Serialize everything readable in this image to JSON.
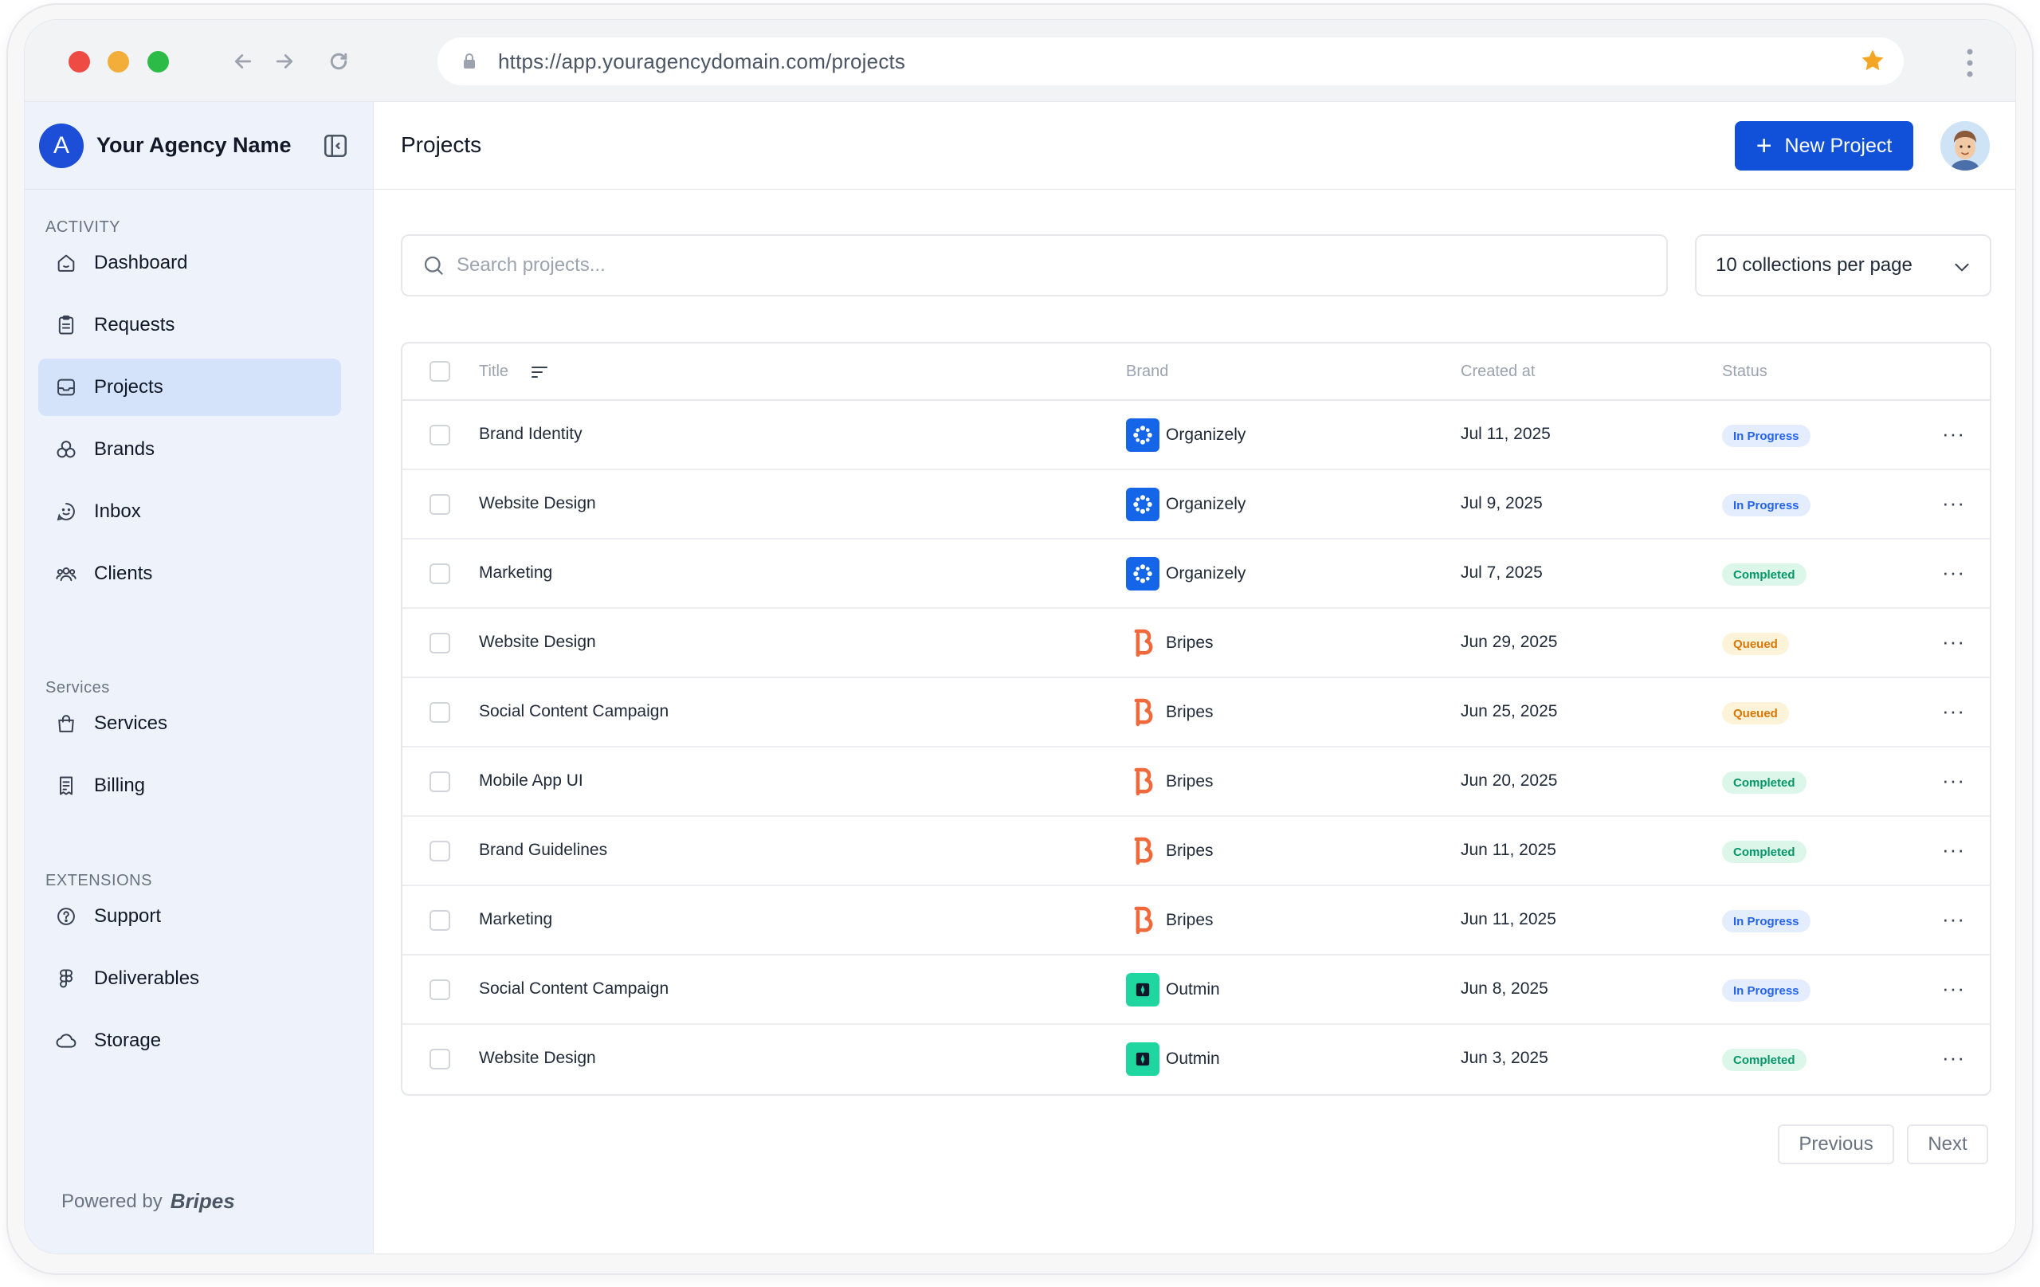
{
  "browser": {
    "url": "https://app.youragencydomain.com/projects"
  },
  "sidebar": {
    "logo_letter": "A",
    "agency_name": "Your Agency Name",
    "sections": {
      "activity": "ACTIVITY",
      "services": "Services",
      "extensions": "EXTENSIONS"
    },
    "items": [
      {
        "label": "Dashboard",
        "icon": "home-icon"
      },
      {
        "label": "Requests",
        "icon": "clipboard-icon"
      },
      {
        "label": "Projects",
        "icon": "inbox-tray-icon",
        "active": true
      },
      {
        "label": "Brands",
        "icon": "circles-icon"
      },
      {
        "label": "Inbox",
        "icon": "chat-smile-icon"
      },
      {
        "label": "Clients",
        "icon": "users-icon"
      },
      {
        "label": "Services",
        "icon": "bag-icon"
      },
      {
        "label": "Billing",
        "icon": "receipt-icon"
      },
      {
        "label": "Support",
        "icon": "question-icon"
      },
      {
        "label": "Deliverables",
        "icon": "figma-icon"
      },
      {
        "label": "Storage",
        "icon": "cloud-icon"
      }
    ],
    "powered_by": "Powered by",
    "powered_brand": "Bripes"
  },
  "header": {
    "title": "Projects",
    "new_project_label": "New Project"
  },
  "search": {
    "placeholder": "Search projects..."
  },
  "per_page": {
    "value": "10 collections per page"
  },
  "table": {
    "columns": {
      "title": "Title",
      "brand": "Brand",
      "created": "Created at",
      "status": "Status"
    },
    "rows": [
      {
        "title": "Brand Identity",
        "brand": "Organizely",
        "created": "Jul 11, 2025",
        "status": "In Progress"
      },
      {
        "title": "Website Design",
        "brand": "Organizely",
        "created": "Jul 9, 2025",
        "status": "In Progress"
      },
      {
        "title": "Marketing",
        "brand": "Organizely",
        "created": "Jul 7, 2025",
        "status": "Completed"
      },
      {
        "title": "Website Design",
        "brand": "Bripes",
        "created": "Jun 29, 2025",
        "status": "Queued"
      },
      {
        "title": "Social Content Campaign",
        "brand": "Bripes",
        "created": "Jun 25, 2025",
        "status": "Queued"
      },
      {
        "title": "Mobile App UI",
        "brand": "Bripes",
        "created": "Jun 20, 2025",
        "status": "Completed"
      },
      {
        "title": "Brand Guidelines",
        "brand": "Bripes",
        "created": "Jun 11, 2025",
        "status": "Completed"
      },
      {
        "title": "Marketing",
        "brand": "Bripes",
        "created": "Jun 11, 2025",
        "status": "In Progress"
      },
      {
        "title": "Social Content Campaign",
        "brand": "Outmin",
        "created": "Jun 8, 2025",
        "status": "In Progress"
      },
      {
        "title": "Website Design",
        "brand": "Outmin",
        "created": "Jun 3, 2025",
        "status": "Completed"
      }
    ],
    "more_glyph": "···"
  },
  "pagination": {
    "previous": "Previous",
    "next": "Next"
  },
  "colors": {
    "accent": "#1151d9",
    "sidebar_bg": "#eef2fb",
    "active_item": "#d4e2fa",
    "status_in_progress": "#2563eb",
    "status_completed": "#059669",
    "status_queued": "#d97706"
  }
}
